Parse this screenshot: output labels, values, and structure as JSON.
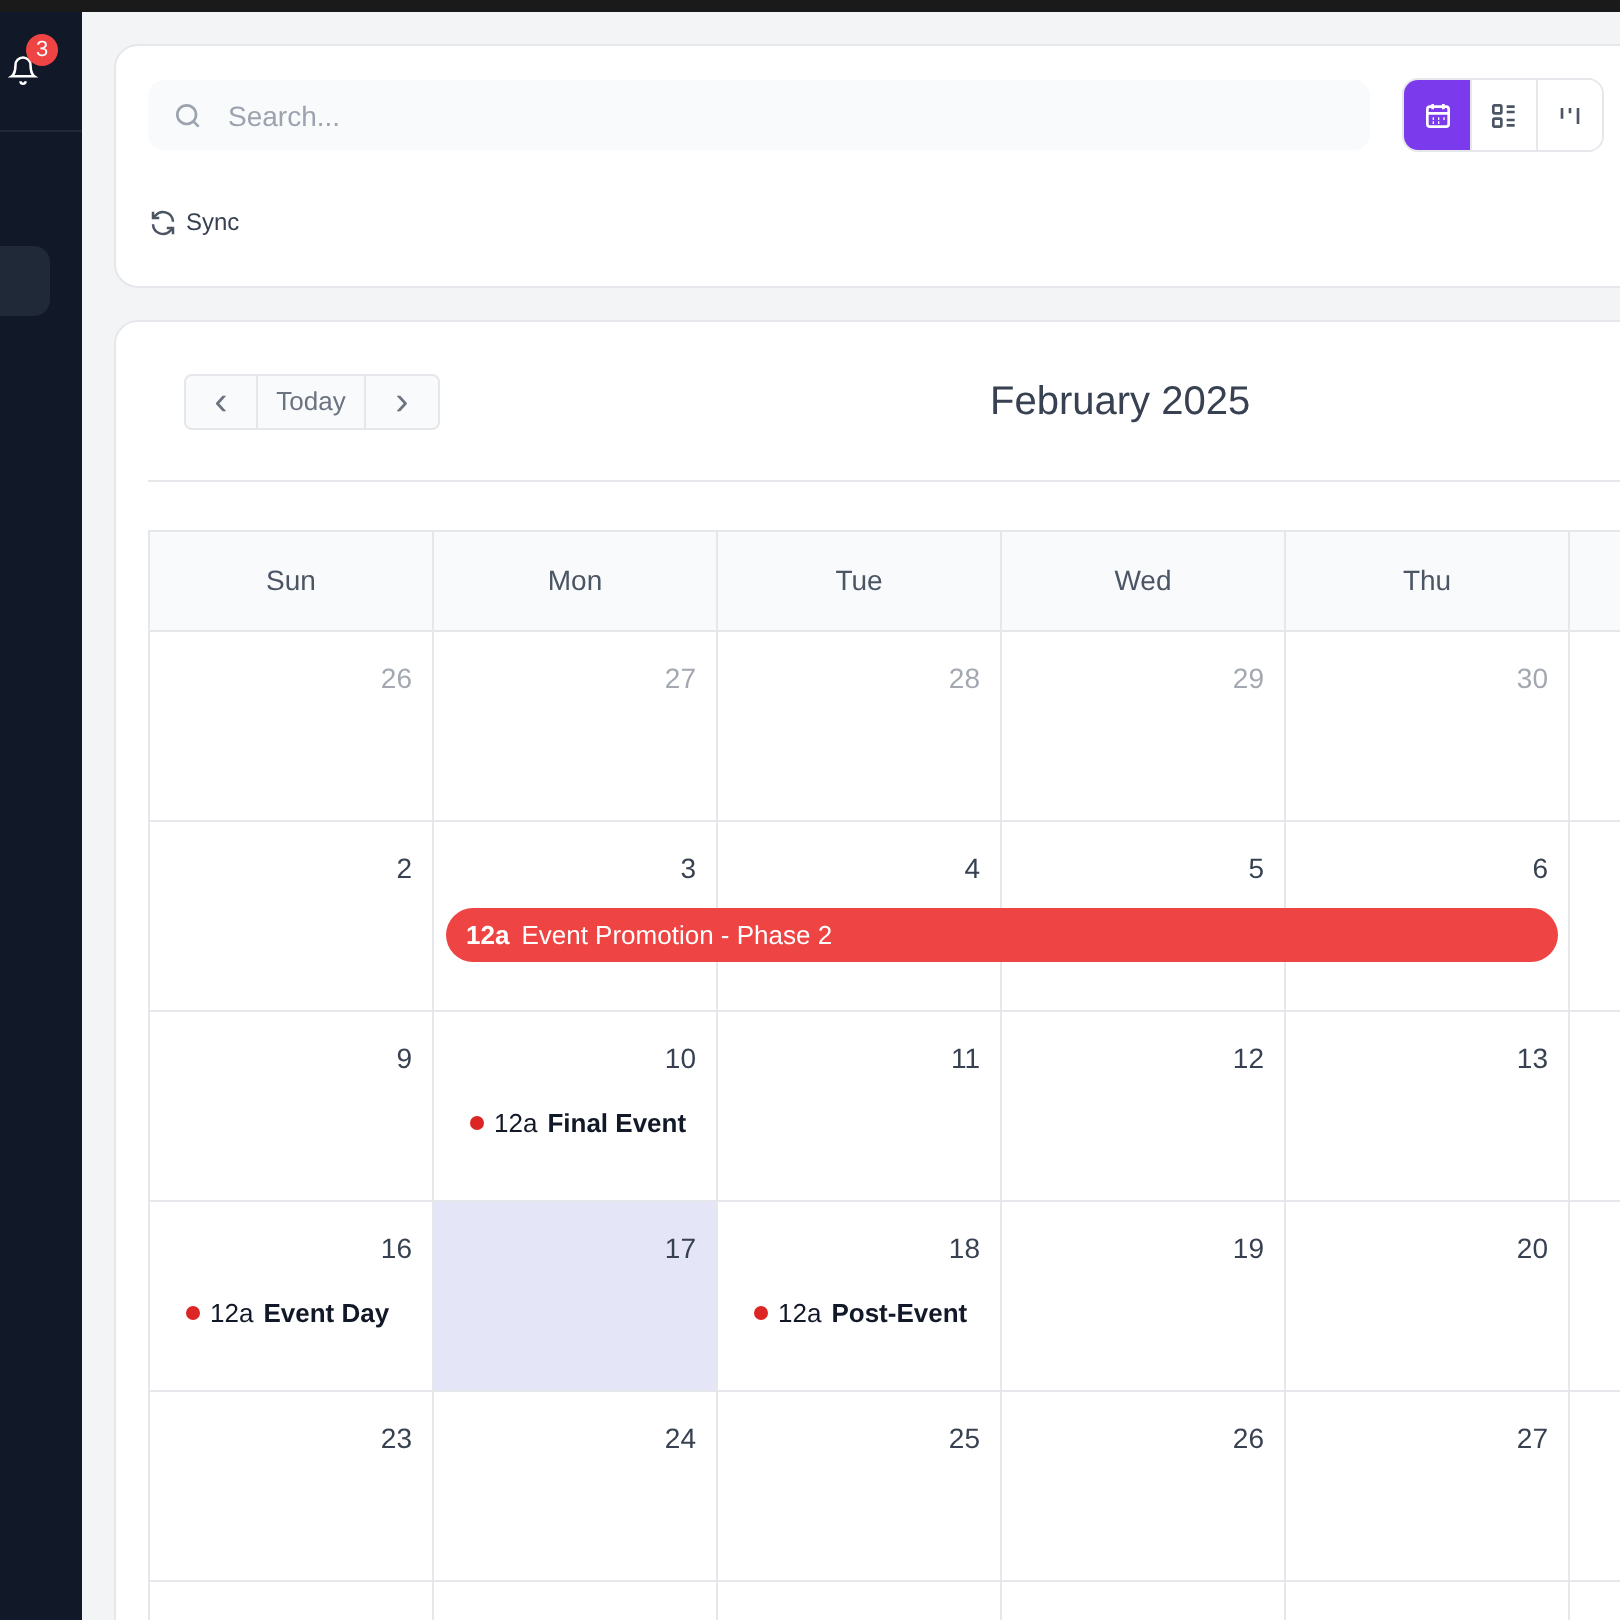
{
  "sidebar": {
    "notifications": {
      "count": "3"
    }
  },
  "toolbar": {
    "search": {
      "placeholder": "Search..."
    },
    "sync": {
      "label": "Sync"
    },
    "views": [
      {
        "kind": "calendar",
        "selected": true
      },
      {
        "kind": "list",
        "selected": false
      },
      {
        "kind": "board",
        "selected": false
      }
    ]
  },
  "calendar": {
    "nav": {
      "prev": "‹",
      "today": "Today",
      "next": "›"
    },
    "title": "February 2025",
    "weekdays": [
      "Sun",
      "Mon",
      "Tue",
      "Wed",
      "Thu"
    ],
    "weeks": [
      {
        "days": [
          {
            "day": "26",
            "muted": true,
            "today": false
          },
          {
            "day": "27",
            "muted": true,
            "today": false
          },
          {
            "day": "28",
            "muted": true,
            "today": false
          },
          {
            "day": "29",
            "muted": true,
            "today": false
          },
          {
            "day": "30",
            "muted": true,
            "today": false
          }
        ]
      },
      {
        "days": [
          {
            "day": "2",
            "muted": false,
            "today": false
          },
          {
            "day": "3",
            "muted": false,
            "today": false
          },
          {
            "day": "4",
            "muted": false,
            "today": false
          },
          {
            "day": "5",
            "muted": false,
            "today": false
          },
          {
            "day": "6",
            "muted": false,
            "today": false
          }
        ],
        "spans": [
          {
            "time": "12a",
            "title": "Event Promotion - Phase 2",
            "color": "#ef4444"
          }
        ]
      },
      {
        "days": [
          {
            "day": "9",
            "muted": false,
            "today": false
          },
          {
            "day": "10",
            "muted": false,
            "today": false,
            "events": [
              {
                "time": "12a",
                "title": "Final Event",
                "color": "#dc2626"
              }
            ]
          },
          {
            "day": "11",
            "muted": false,
            "today": false
          },
          {
            "day": "12",
            "muted": false,
            "today": false
          },
          {
            "day": "13",
            "muted": false,
            "today": false
          }
        ]
      },
      {
        "days": [
          {
            "day": "16",
            "muted": false,
            "today": false,
            "events": [
              {
                "time": "12a",
                "title": "Event Day",
                "color": "#dc2626"
              }
            ]
          },
          {
            "day": "17",
            "muted": false,
            "today": true
          },
          {
            "day": "18",
            "muted": false,
            "today": false,
            "events": [
              {
                "time": "12a",
                "title": "Post-Event",
                "color": "#dc2626"
              }
            ]
          },
          {
            "day": "19",
            "muted": false,
            "today": false
          },
          {
            "day": "20",
            "muted": false,
            "today": false
          }
        ]
      },
      {
        "days": [
          {
            "day": "23",
            "muted": false,
            "today": false
          },
          {
            "day": "24",
            "muted": false,
            "today": false
          },
          {
            "day": "25",
            "muted": false,
            "today": false
          },
          {
            "day": "26",
            "muted": false,
            "today": false
          },
          {
            "day": "27",
            "muted": false,
            "today": false
          }
        ]
      }
    ]
  }
}
